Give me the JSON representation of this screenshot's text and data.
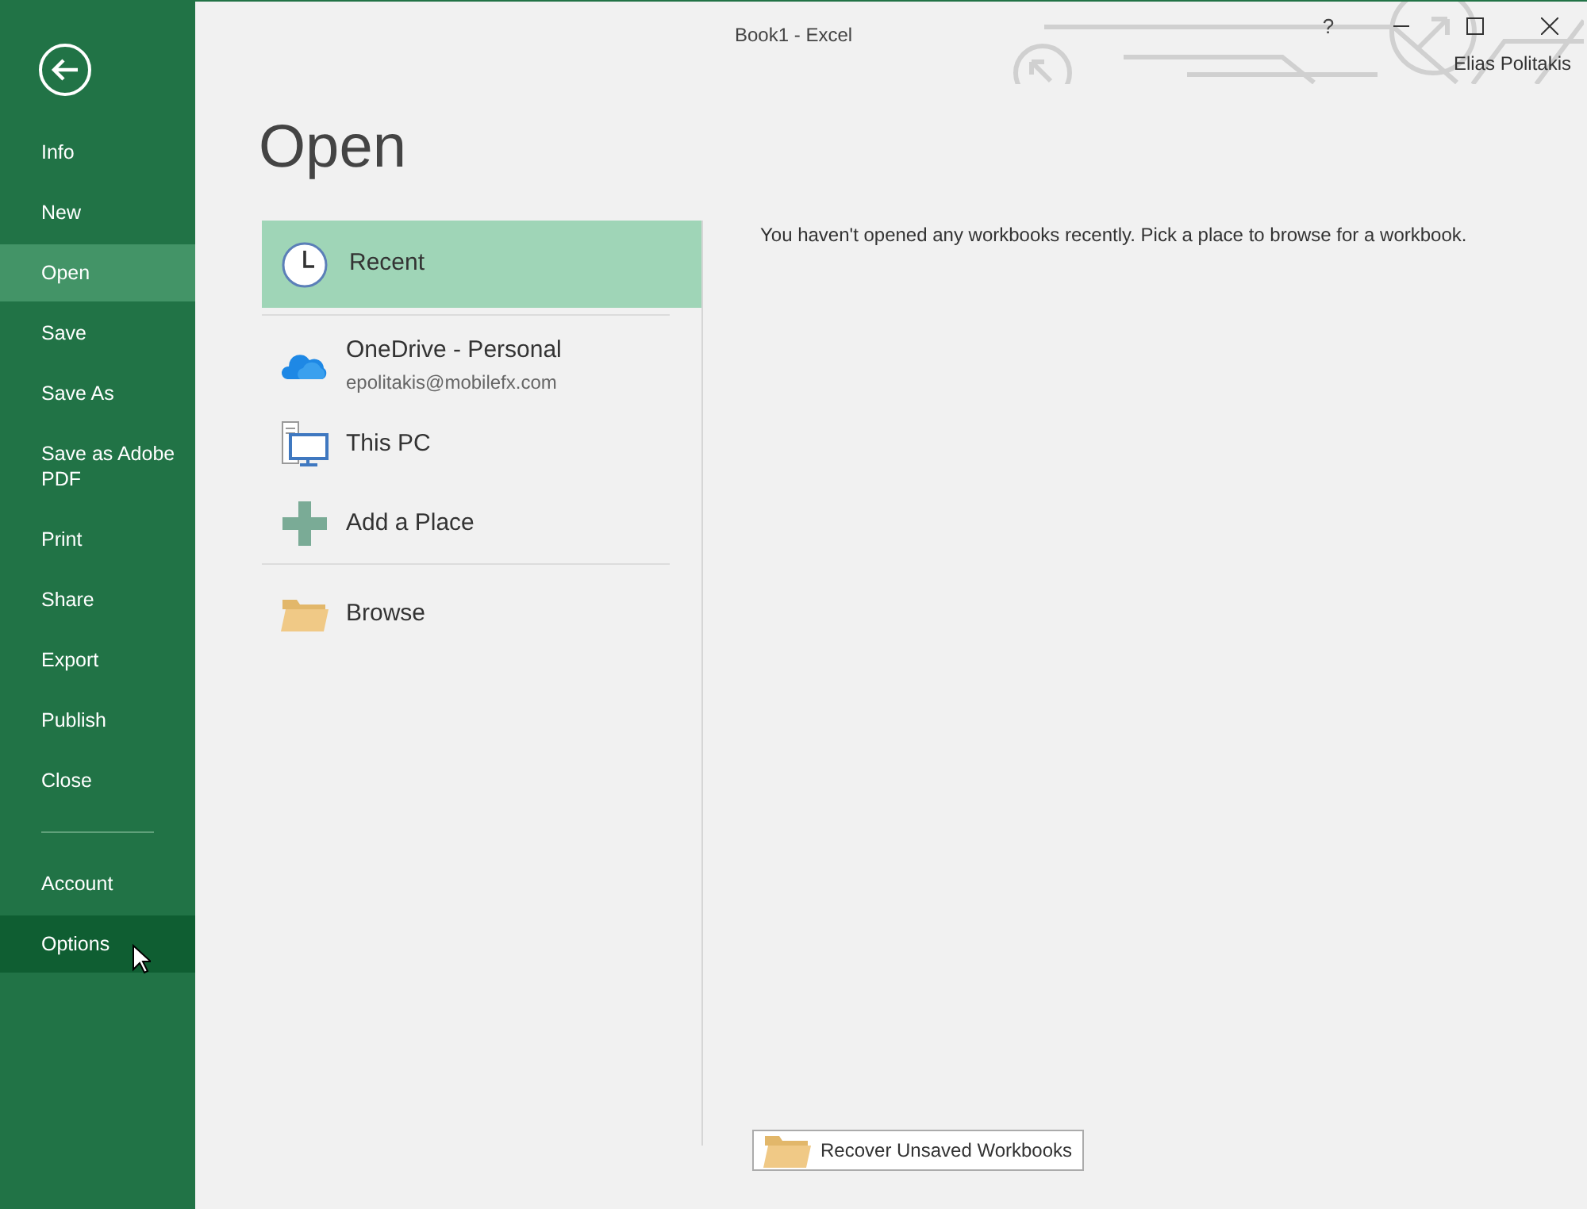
{
  "window": {
    "title": "Book1 - Excel",
    "user": "Elias Politakis",
    "controls": [
      "?"
    ]
  },
  "sidebar": {
    "items": [
      {
        "label": "Info",
        "selected": false,
        "hovered": false
      },
      {
        "label": "New",
        "selected": false,
        "hovered": false
      },
      {
        "label": "Open",
        "selected": true,
        "hovered": false
      },
      {
        "label": "Save",
        "selected": false,
        "hovered": false
      },
      {
        "label": "Save As",
        "selected": false,
        "hovered": false
      },
      {
        "label": "Save as Adobe PDF",
        "selected": false,
        "hovered": false
      },
      {
        "label": "Print",
        "selected": false,
        "hovered": false
      },
      {
        "label": "Share",
        "selected": false,
        "hovered": false
      },
      {
        "label": "Export",
        "selected": false,
        "hovered": false
      },
      {
        "label": "Publish",
        "selected": false,
        "hovered": false
      },
      {
        "label": "Close",
        "selected": false,
        "hovered": false
      }
    ],
    "bottom_items": [
      {
        "label": "Account",
        "selected": false,
        "hovered": false
      },
      {
        "label": "Options",
        "selected": false,
        "hovered": true
      }
    ]
  },
  "page_title": "Open",
  "place_groups": [
    {
      "items": [
        {
          "kind": "clock",
          "label": "Recent",
          "selected": true
        }
      ]
    },
    {
      "items": [
        {
          "kind": "cloud",
          "label": "OneDrive - Personal",
          "sublabel": "epolitakis@mobilefx.com",
          "selected": false
        },
        {
          "kind": "pc",
          "label": "This PC",
          "selected": false
        },
        {
          "kind": "plus",
          "label": "Add a Place",
          "selected": false
        }
      ]
    },
    {
      "items": [
        {
          "kind": "folder",
          "label": "Browse",
          "selected": false
        }
      ]
    }
  ],
  "message": "You haven't opened any workbooks recently. Pick a place to browse for a workbook.",
  "recover_button": "Recover Unsaved Workbooks"
}
